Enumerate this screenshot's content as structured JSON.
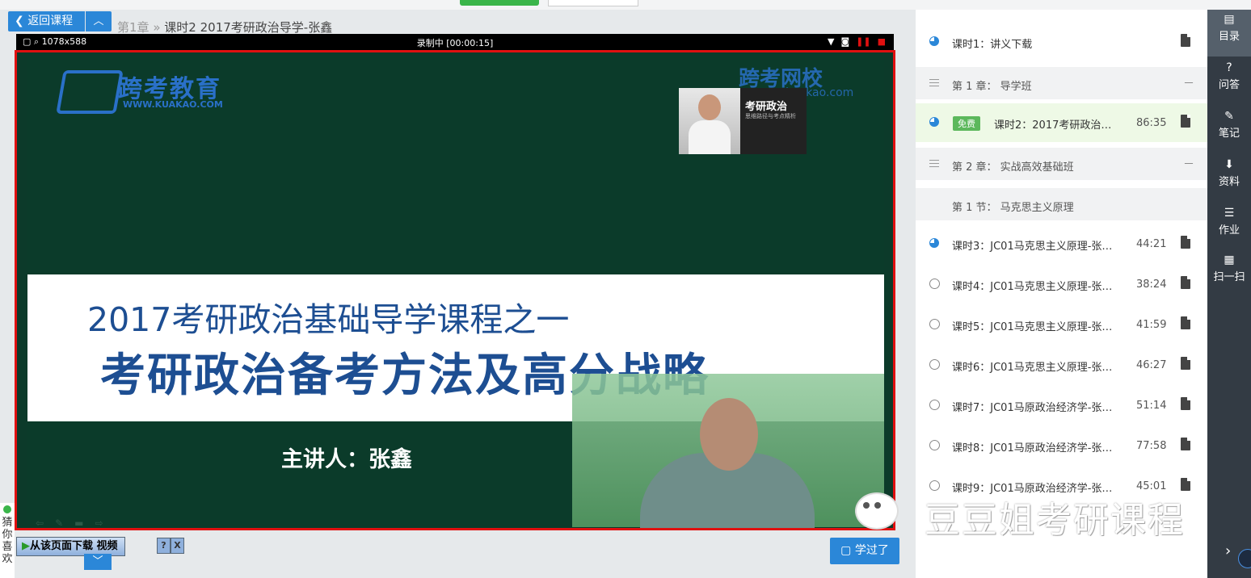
{
  "nav_header": {
    "back_label": "返回课程",
    "breadcrumb_chapter": "第1章",
    "breadcrumb_sep": "»",
    "breadcrumb_lesson": "课时2  2017考研政治导学-张鑫"
  },
  "player": {
    "resolution": "1078x588",
    "recording": "录制中 [00:00:15]",
    "logo_left": "跨考教育",
    "logo_left_url": "WWW.KUAKAO.COM",
    "logo_right": "跨考网校",
    "logo_right_url": "e.kuakao.com",
    "book_title": "考研政治",
    "book_subtitle": "思维路径与考点精析",
    "banner_line1": "2017考研政治基础导学课程之一",
    "banner_line2": "考研政治备考方法及高分战略",
    "presenter": "主讲人：张鑫"
  },
  "download_bar": {
    "label": "从该页面下载 视频",
    "help": "?",
    "close": "X"
  },
  "learned_label": "学过了",
  "guess_label": [
    "猜",
    "你",
    "喜",
    "欢"
  ],
  "catalog": {
    "rows": [
      {
        "type": "lesson",
        "icon": "pie",
        "label": "课时1：讲义下载",
        "duration": "",
        "doc_icon": "image-doc-icon"
      },
      {
        "type": "chapter",
        "label": "第 1 章：  导学班",
        "collapse": "－"
      },
      {
        "type": "lesson",
        "icon": "pie",
        "free": "免费",
        "label": "课时2：2017考研政治…",
        "duration": "86:35",
        "active": true
      },
      {
        "type": "chapter",
        "label": "第 2 章：  实战高效基础班",
        "collapse": "－"
      },
      {
        "type": "section",
        "label": "第 1 节：  马克思主义原理"
      },
      {
        "type": "lesson",
        "icon": "pie",
        "label": "课时3：JC01马克思主义原理-张…",
        "duration": "44:21"
      },
      {
        "type": "lesson",
        "icon": "circle",
        "label": "课时4：JC01马克思主义原理-张…",
        "duration": "38:24"
      },
      {
        "type": "lesson",
        "icon": "circle",
        "label": "课时5：JC01马克思主义原理-张…",
        "duration": "41:59"
      },
      {
        "type": "lesson",
        "icon": "circle",
        "label": "课时6：JC01马克思主义原理-张…",
        "duration": "46:27"
      },
      {
        "type": "lesson",
        "icon": "circle",
        "label": "课时7：JC01马原政治经济学-张…",
        "duration": "51:14"
      },
      {
        "type": "lesson",
        "icon": "circle",
        "label": "课时8：JC01马原政治经济学-张…",
        "duration": "77:58"
      },
      {
        "type": "lesson",
        "icon": "circle",
        "label": "课时9：JC01马原政治经济学-张…",
        "duration": "45:01"
      }
    ]
  },
  "watermark": "豆豆姐考研课程",
  "side_nav": [
    {
      "icon": "list-icon",
      "glyph": "▤",
      "label": "目录",
      "active": true
    },
    {
      "icon": "question-icon",
      "glyph": "?",
      "label": "问答"
    },
    {
      "icon": "note-icon",
      "glyph": "✎",
      "label": "笔记"
    },
    {
      "icon": "download-icon",
      "glyph": "⬇",
      "label": "资料"
    },
    {
      "icon": "homework-icon",
      "glyph": "☰",
      "label": "作业"
    },
    {
      "icon": "qrcode-icon",
      "glyph": "▦",
      "label": "扫一扫"
    }
  ],
  "colors": {
    "accent": "#2b87d8",
    "frame_red": "#e01010",
    "free_green": "#5cb85c",
    "nav_bg": "#333b44"
  }
}
